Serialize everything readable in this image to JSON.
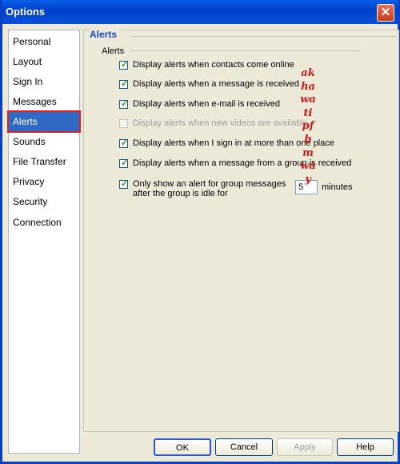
{
  "window": {
    "title": "Options"
  },
  "nav": {
    "items": [
      {
        "label": "Personal"
      },
      {
        "label": "Layout"
      },
      {
        "label": "Sign In"
      },
      {
        "label": "Messages"
      },
      {
        "label": "Alerts",
        "selected": true
      },
      {
        "label": "Sounds"
      },
      {
        "label": "File Transfer"
      },
      {
        "label": "Privacy"
      },
      {
        "label": "Security"
      },
      {
        "label": "Connection"
      }
    ]
  },
  "panel": {
    "title": "Alerts",
    "group_label": "Alerts",
    "options": [
      {
        "label": "Display alerts when contacts come online",
        "checked": true,
        "enabled": true
      },
      {
        "label": "Display alerts when a message is received",
        "checked": true,
        "enabled": true
      },
      {
        "label": "Display alerts when e-mail is received",
        "checked": true,
        "enabled": true
      },
      {
        "label": "Display alerts when new videos are available",
        "checked": false,
        "enabled": false
      },
      {
        "label": "Display alerts when I sign in at more than one place",
        "checked": true,
        "enabled": true
      },
      {
        "label": "Display alerts when a message from a group is received",
        "checked": true,
        "enabled": true
      },
      {
        "label": "Only show an alert for group messages after the group is idle for",
        "checked": true,
        "enabled": true
      }
    ],
    "idle_minutes_value": "5",
    "idle_minutes_unit": "minutes"
  },
  "watermark": "akhawatipfbmway",
  "buttons": {
    "ok": "OK",
    "cancel": "Cancel",
    "apply": "Apply",
    "help": "Help"
  },
  "colors": {
    "title_bar": "#0a4fd8",
    "selected_nav": "#316ac5",
    "highlight_box": "#e02020",
    "watermark": "#c61a1a"
  }
}
